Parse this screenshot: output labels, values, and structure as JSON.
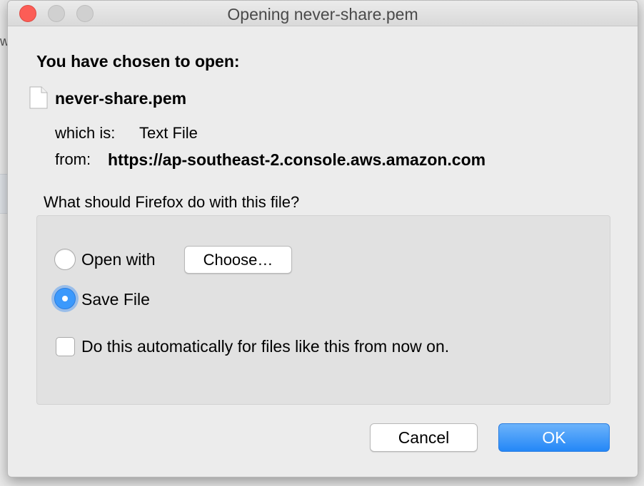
{
  "dialog": {
    "title": "Opening never-share.pem",
    "heading": "You have chosen to open:",
    "filename": "never-share.pem",
    "which_label": "which is:",
    "which_value": "Text File",
    "from_label": "from:",
    "from_value": "https://ap-southeast-2.console.aws.amazon.com",
    "question": "What should Firefox do with this file?",
    "options": {
      "open_with_label": "Open with",
      "choose_label": "Choose…",
      "save_file_label": "Save File",
      "selected": "Save File",
      "auto_label": "Do this automatically for files like this from now on.",
      "auto_checked": false
    },
    "buttons": {
      "cancel": "Cancel",
      "ok": "OK"
    }
  },
  "background": {
    "partial_text": "w"
  },
  "colors": {
    "accent": "#2487f7",
    "close_button": "#fc5d56"
  }
}
